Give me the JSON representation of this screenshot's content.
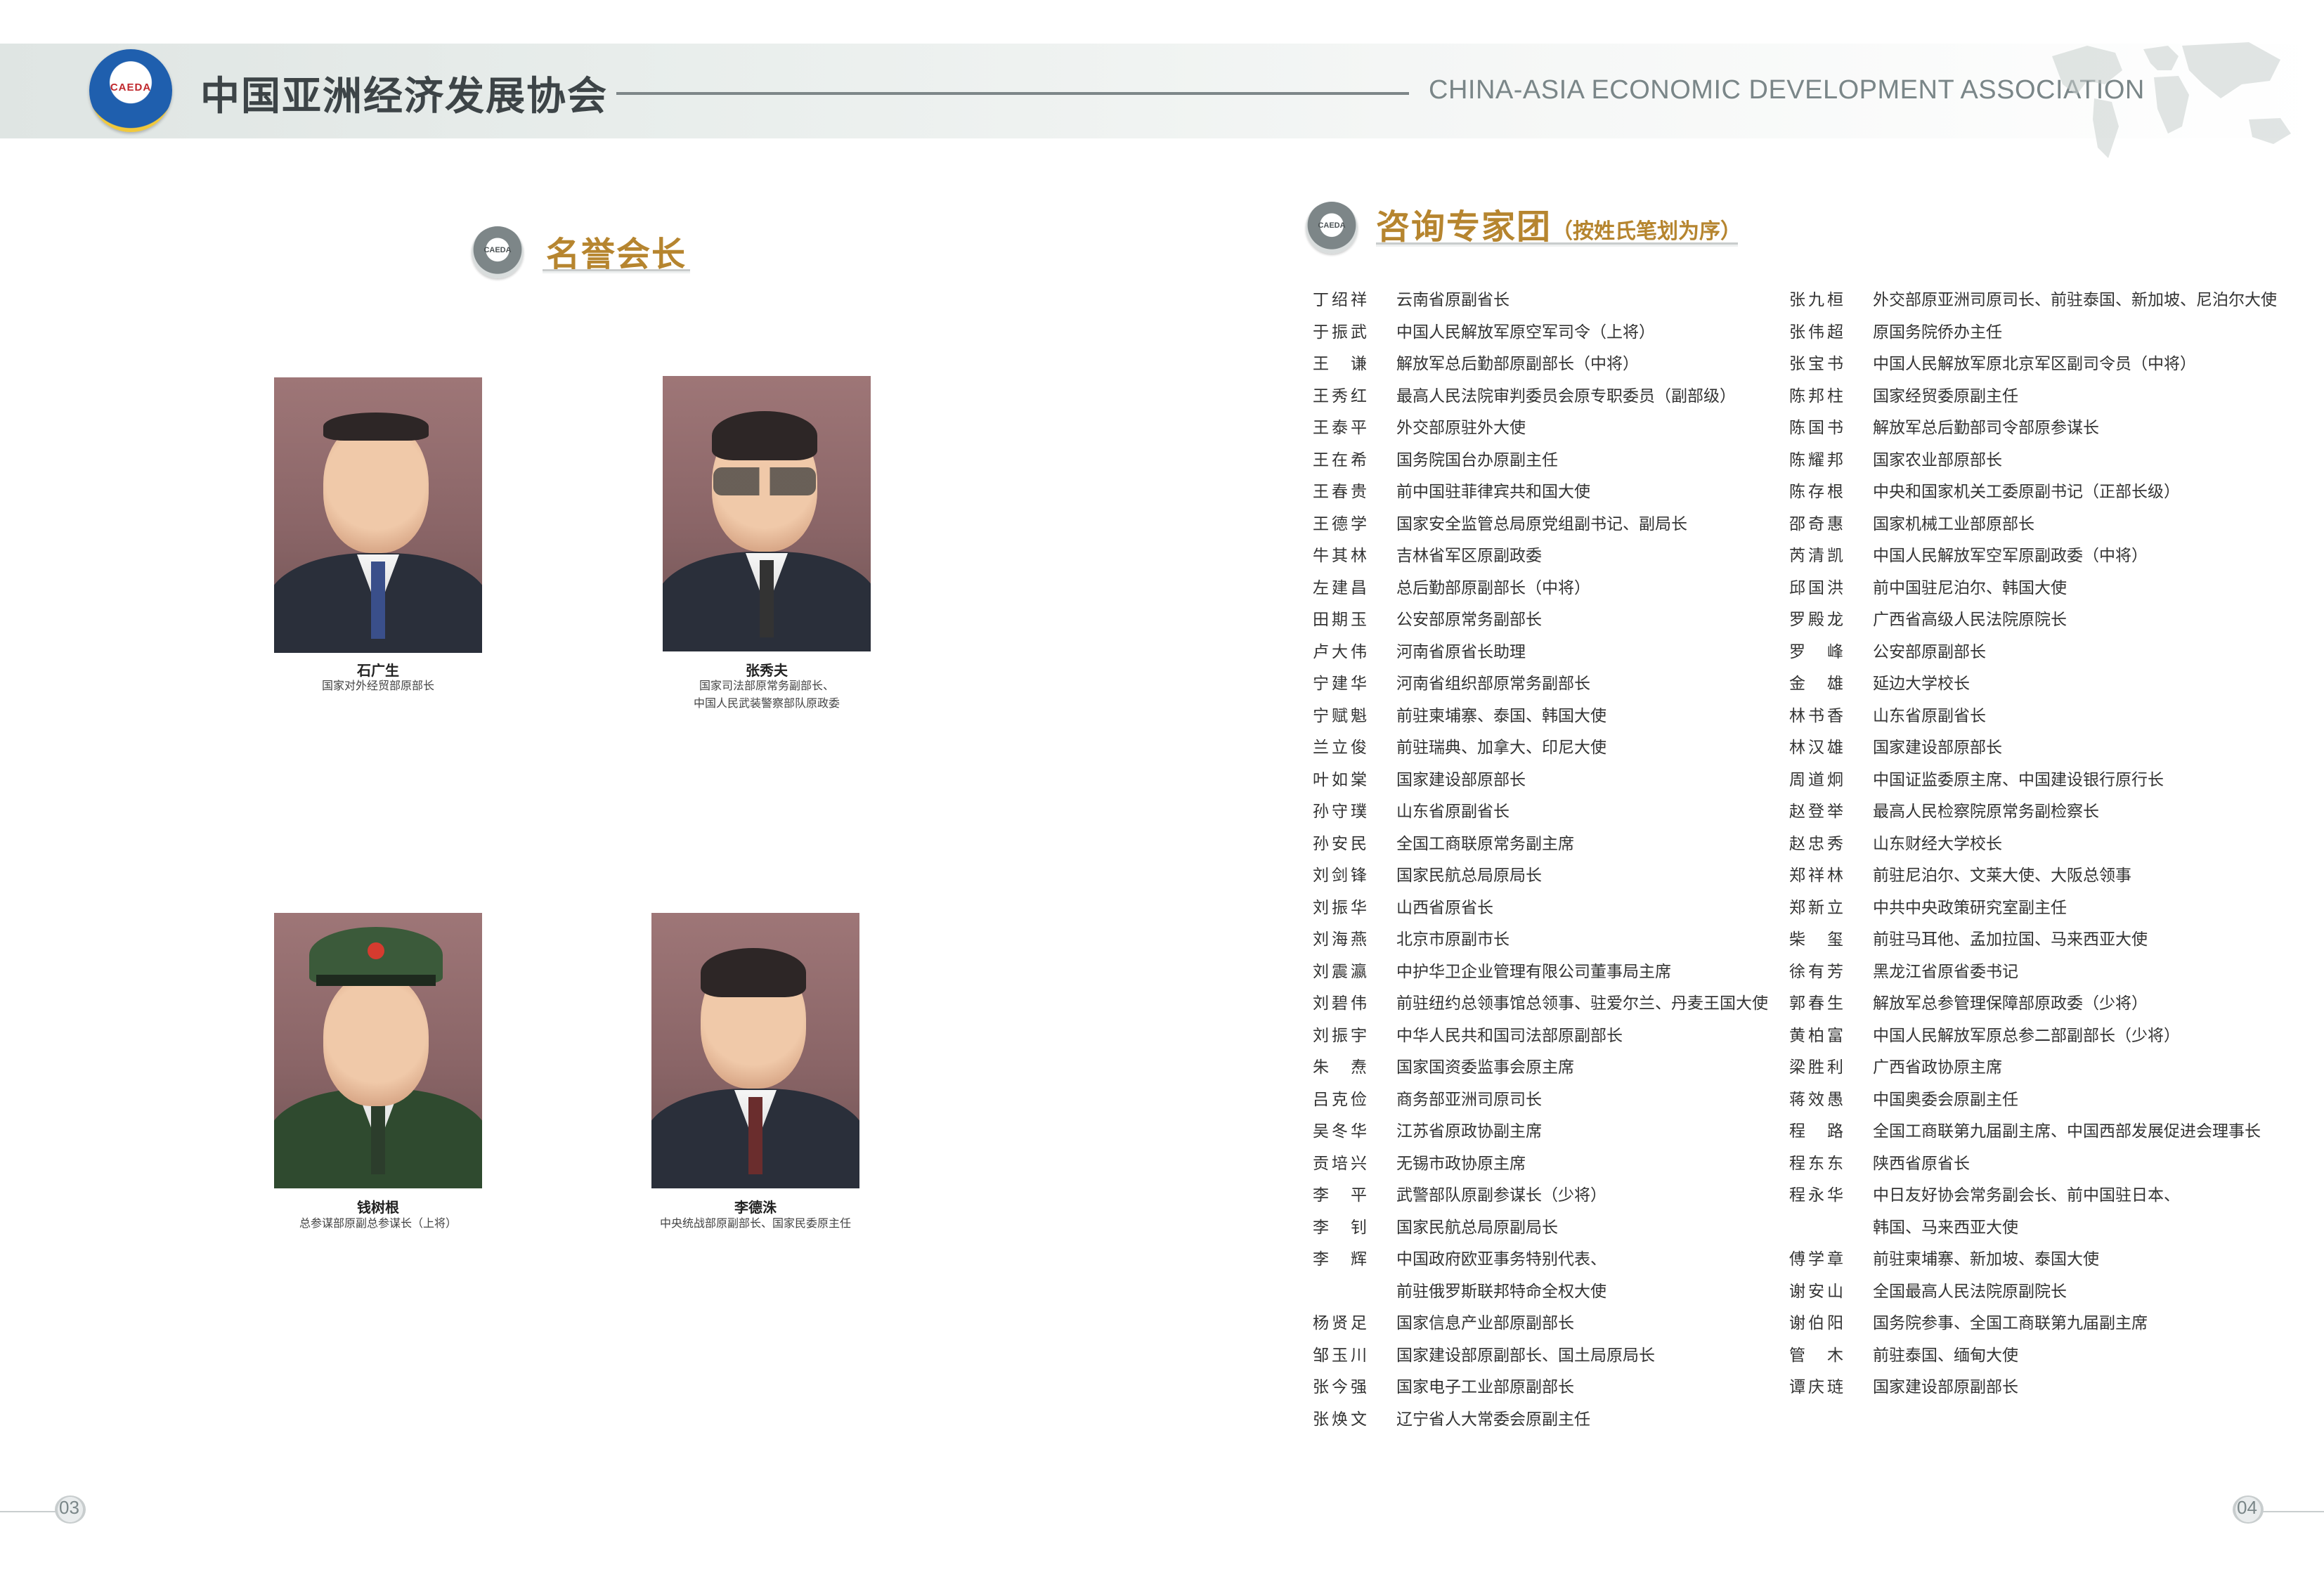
{
  "header": {
    "logo_text": "CAEDA",
    "title_cn": "中国亚洲经济发展协会",
    "title_en": "CHINA-ASIA ECONOMIC DEVELOPMENT ASSOCIATION"
  },
  "honorary": {
    "badge_text": "CAEDA",
    "heading": "名誉会长",
    "people": [
      {
        "name": "石广生",
        "title_lines": [
          "国家对外经贸部原部长"
        ]
      },
      {
        "name": "张秀夫",
        "title_lines": [
          "国家司法部原常务副部长、",
          "中国人民武装警察部队原政委"
        ]
      },
      {
        "name": "钱树根",
        "title_lines": [
          "总参谋部原副总参谋长（上将）"
        ]
      },
      {
        "name": "李德洙",
        "title_lines": [
          "中央统战部原副部长、国家民委原主任"
        ]
      }
    ]
  },
  "experts": {
    "badge_text": "CAEDA",
    "heading": "咨询专家团",
    "heading_sub": "（按姓氏笔划为序）",
    "left": [
      {
        "name": "丁绍祥",
        "pos": "云南省原副省长"
      },
      {
        "name": "于振武",
        "pos": "中国人民解放军原空军司令（上将）"
      },
      {
        "name": "王谦",
        "pos": "解放军总后勤部原副部长（中将）"
      },
      {
        "name": "王秀红",
        "pos": "最高人民法院审判委员会原专职委员（副部级）"
      },
      {
        "name": "王泰平",
        "pos": "外交部原驻外大使"
      },
      {
        "name": "王在希",
        "pos": "国务院国台办原副主任"
      },
      {
        "name": "王春贵",
        "pos": "前中国驻菲律宾共和国大使"
      },
      {
        "name": "王德学",
        "pos": "国家安全监管总局原党组副书记、副局长"
      },
      {
        "name": "牛其林",
        "pos": "吉林省军区原副政委"
      },
      {
        "name": "左建昌",
        "pos": "总后勤部原副部长（中将）"
      },
      {
        "name": "田期玉",
        "pos": "公安部原常务副部长"
      },
      {
        "name": "卢大伟",
        "pos": "河南省原省长助理"
      },
      {
        "name": "宁建华",
        "pos": "河南省组织部原常务副部长"
      },
      {
        "name": "宁赋魁",
        "pos": "前驻柬埔寨、泰国、韩国大使"
      },
      {
        "name": "兰立俊",
        "pos": "前驻瑞典、加拿大、印尼大使"
      },
      {
        "name": "叶如棠",
        "pos": "国家建设部原部长"
      },
      {
        "name": "孙守璞",
        "pos": "山东省原副省长"
      },
      {
        "name": "孙安民",
        "pos": "全国工商联原常务副主席"
      },
      {
        "name": "刘剑锋",
        "pos": "国家民航总局原局长"
      },
      {
        "name": "刘振华",
        "pos": "山西省原省长"
      },
      {
        "name": "刘海燕",
        "pos": "北京市原副市长"
      },
      {
        "name": "刘震瀛",
        "pos": "中护华卫企业管理有限公司董事局主席"
      },
      {
        "name": "刘碧伟",
        "pos": "前驻纽约总领事馆总领事、驻爱尔兰、丹麦王国大使"
      },
      {
        "name": "刘振宇",
        "pos": "中华人民共和国司法部原副部长"
      },
      {
        "name": "朱焘",
        "pos": "国家国资委监事会原主席"
      },
      {
        "name": "吕克俭",
        "pos": "商务部亚洲司原司长"
      },
      {
        "name": "吴冬华",
        "pos": "江苏省原政协副主席"
      },
      {
        "name": "贡培兴",
        "pos": "无锡市政协原主席"
      },
      {
        "name": "李平",
        "pos": "武警部队原副参谋长（少将）"
      },
      {
        "name": "李钊",
        "pos": "国家民航总局原副局长"
      },
      {
        "name": "李辉",
        "pos": "中国政府欧亚事务特别代表、"
      },
      {
        "name": "",
        "pos": "前驻俄罗斯联邦特命全权大使"
      },
      {
        "name": "杨贤足",
        "pos": "国家信息产业部原副部长"
      },
      {
        "name": "邹玉川",
        "pos": "国家建设部原副部长、国土局原局长"
      },
      {
        "name": "张今强",
        "pos": "国家电子工业部原副部长"
      },
      {
        "name": "张焕文",
        "pos": "辽宁省人大常委会原副主任"
      }
    ],
    "right": [
      {
        "name": "张九桓",
        "pos": "外交部原亚洲司原司长、前驻泰国、新加坡、尼泊尔大使"
      },
      {
        "name": "张伟超",
        "pos": "原国务院侨办主任"
      },
      {
        "name": "张宝书",
        "pos": "中国人民解放军原北京军区副司令员（中将）"
      },
      {
        "name": "陈邦柱",
        "pos": "国家经贸委原副主任"
      },
      {
        "name": "陈国书",
        "pos": "解放军总后勤部司令部原参谋长"
      },
      {
        "name": "陈耀邦",
        "pos": "国家农业部原部长"
      },
      {
        "name": "陈存根",
        "pos": "中央和国家机关工委原副书记（正部长级）"
      },
      {
        "name": "邵奇惠",
        "pos": "国家机械工业部原部长"
      },
      {
        "name": "芮清凯",
        "pos": "中国人民解放军空军原副政委（中将）"
      },
      {
        "name": "邱国洪",
        "pos": "前中国驻尼泊尔、韩国大使"
      },
      {
        "name": "罗殿龙",
        "pos": "广西省高级人民法院原院长"
      },
      {
        "name": "罗峰",
        "pos": "公安部原副部长"
      },
      {
        "name": "金雄",
        "pos": "延边大学校长"
      },
      {
        "name": "林书香",
        "pos": "山东省原副省长"
      },
      {
        "name": "林汉雄",
        "pos": "国家建设部原部长"
      },
      {
        "name": "周道炯",
        "pos": "中国证监委原主席、中国建设银行原行长"
      },
      {
        "name": "赵登举",
        "pos": "最高人民检察院原常务副检察长"
      },
      {
        "name": "赵忠秀",
        "pos": "山东财经大学校长"
      },
      {
        "name": "郑祥林",
        "pos": "前驻尼泊尔、文莱大使、大阪总领事"
      },
      {
        "name": "郑新立",
        "pos": "中共中央政策研究室副主任"
      },
      {
        "name": "柴玺",
        "pos": "前驻马耳他、孟加拉国、马来西亚大使"
      },
      {
        "name": "徐有芳",
        "pos": "黑龙江省原省委书记"
      },
      {
        "name": "郭春生",
        "pos": "解放军总参管理保障部原政委（少将）"
      },
      {
        "name": "黄柏富",
        "pos": "中国人民解放军原总参二部副部长（少将）"
      },
      {
        "name": "梁胜利",
        "pos": "广西省政协原主席"
      },
      {
        "name": "蒋效愚",
        "pos": "中国奥委会原副主任"
      },
      {
        "name": "程路",
        "pos": "全国工商联第九届副主席、中国西部发展促进会理事长"
      },
      {
        "name": "程东东",
        "pos": "陕西省原省长"
      },
      {
        "name": "程永华",
        "pos": "中日友好协会常务副会长、前中国驻日本、"
      },
      {
        "name": "",
        "pos": "韩国、马来西亚大使"
      },
      {
        "name": "傅学章",
        "pos": "前驻柬埔寨、新加坡、泰国大使"
      },
      {
        "name": "谢安山",
        "pos": "全国最高人民法院原副院长"
      },
      {
        "name": "谢伯阳",
        "pos": "国务院参事、全国工商联第九届副主席"
      },
      {
        "name": "管木",
        "pos": "前驻泰国、缅甸大使"
      },
      {
        "name": "谭庆琏",
        "pos": "国家建设部原副部长"
      }
    ]
  },
  "footer": {
    "page_left": "03",
    "page_right": "04"
  }
}
